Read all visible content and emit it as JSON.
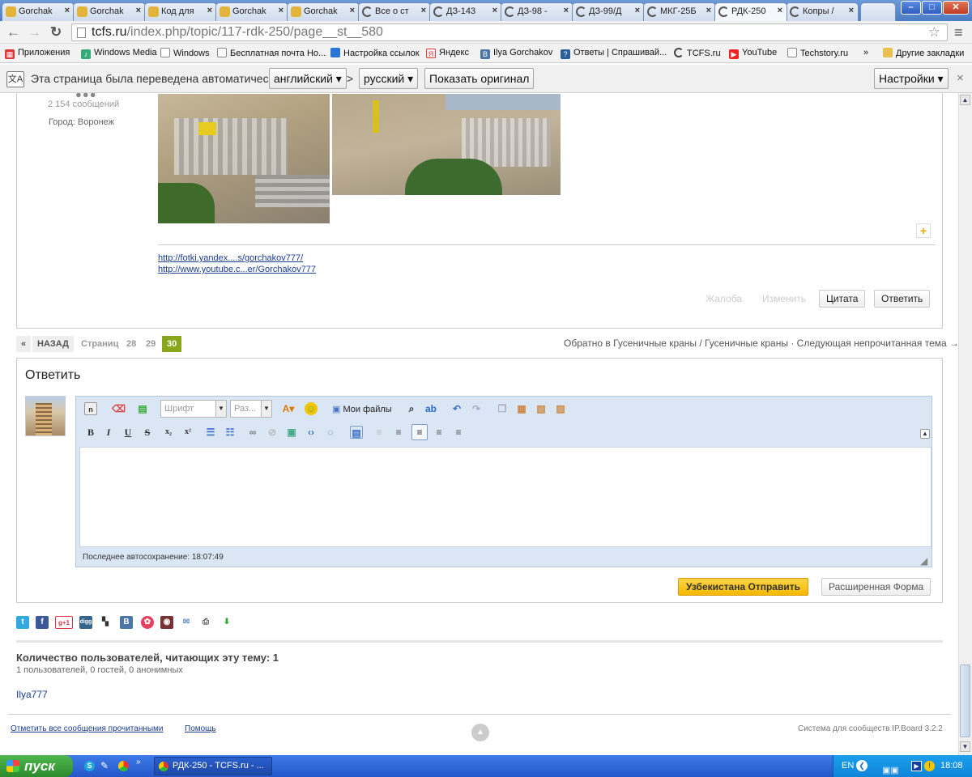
{
  "browser": {
    "tabs": [
      {
        "label": "Gorchak",
        "icon": "gorchak-favicon"
      },
      {
        "label": "Gorchak",
        "icon": "gorchak-favicon"
      },
      {
        "label": "Код для",
        "icon": "gorchak-favicon"
      },
      {
        "label": "Gorchak",
        "icon": "gorchak-favicon"
      },
      {
        "label": "Gorchak",
        "icon": "gorchak-favicon"
      },
      {
        "label": "Все о ст",
        "icon": "tcfs-favicon"
      },
      {
        "label": "ДЗ-143",
        "icon": "tcfs-favicon"
      },
      {
        "label": "ДЗ-98 -",
        "icon": "tcfs-favicon"
      },
      {
        "label": "ДЗ-99/Д",
        "icon": "tcfs-favicon"
      },
      {
        "label": "МКГ-25Б",
        "icon": "tcfs-favicon"
      },
      {
        "label": "РДК-250",
        "icon": "tcfs-favicon",
        "active": true
      },
      {
        "label": "Копры /",
        "icon": "tcfs-favicon"
      }
    ],
    "url_host": "tcfs.ru",
    "url_path": "/index.php/topic/117-rdk-250/page__st__580",
    "bookmarks": [
      {
        "label": "Приложения"
      },
      {
        "label": "Windows Media"
      },
      {
        "label": "Windows"
      },
      {
        "label": "Бесплатная почта Но..."
      },
      {
        "label": "Настройка ссылок"
      },
      {
        "label": "Яндекс"
      },
      {
        "label": "Ilya Gorchakov"
      },
      {
        "label": "Ответы | Спрашивай..."
      },
      {
        "label": "TCFS.ru"
      },
      {
        "label": "YouTube"
      },
      {
        "label": "Techstory.ru"
      }
    ],
    "bookmarks_more": "»",
    "other_bookmarks": "Другие закладки"
  },
  "translate_bar": {
    "message": "Эта страница была переведена автоматически",
    "from_lang": "английский",
    "arrow": ">",
    "to_lang": "русский",
    "show_original": "Показать оригинал",
    "settings": "Настройки",
    "close": "×"
  },
  "post": {
    "author_posts": "2 154 сообщений",
    "city_label": "Город:",
    "city_value": "Воронеж",
    "links": [
      "http://fotki.yandex....s/gorchakov777/",
      "http://www.youtube.c...er/Gorchakov777"
    ],
    "report": "Жалоба",
    "edit": "Изменить",
    "quote": "Цитата",
    "reply": "Ответить"
  },
  "pagination": {
    "prev": "«",
    "back": "НАЗАД",
    "pages_label": "Страниц",
    "pages": [
      "28",
      "29",
      "30"
    ],
    "current": "30",
    "right_text": "Обратно в Гусеничные краны / Гусеничные краны · Следующая непрочитанная тема →"
  },
  "reply_form": {
    "title": "Ответить",
    "font_placeholder": "Шрифт",
    "size_placeholder": "Раз...",
    "my_files": "Мои файлы",
    "autosave": "Последнее автосохранение: 18:07:49",
    "submit": "Узбекистана Отправить",
    "advanced": "Расширенная Форма"
  },
  "online": {
    "title": "Количество пользователей, читающих эту тему: 1",
    "subtitle": "1 пользователей, 0 гостей, 0 анонимных",
    "user": "Ilya777"
  },
  "footer": {
    "mark_read": "Отметить все сообщения прочитанными",
    "help": "Помощь",
    "powered": "Система для сообществ IP.Board 3.2.2"
  },
  "taskbar": {
    "start": "пуск",
    "window": "РДК-250 - TCFS.ru - ...",
    "lang": "EN",
    "time": "18:08"
  },
  "colors": {
    "accent_green": "#8aa61a",
    "submit_yellow": "#f7c325",
    "link_blue": "#1a3d8f"
  }
}
